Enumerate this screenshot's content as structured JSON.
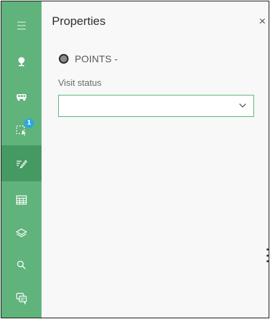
{
  "panel": {
    "title": "Properties",
    "close_label": "×",
    "layer": {
      "name": "POINTS -",
      "color": "#8c8c8c"
    },
    "field": {
      "label": "Visit status",
      "value": ""
    }
  },
  "sidebar": {
    "background": "#5fb37b",
    "active_background": "#449a62",
    "items": [
      {
        "icon": "menu-icon"
      },
      {
        "icon": "tree-icon"
      },
      {
        "icon": "vehicle-icon"
      },
      {
        "icon": "selection-icon",
        "badge": "1"
      },
      {
        "icon": "edit-icon",
        "active": true
      },
      {
        "icon": "table-icon"
      },
      {
        "icon": "layers-icon"
      },
      {
        "icon": "search-icon"
      },
      {
        "icon": "chat-icon"
      }
    ]
  },
  "colors": {
    "accent": "#5fb37b",
    "badge": "#29a8e0"
  }
}
